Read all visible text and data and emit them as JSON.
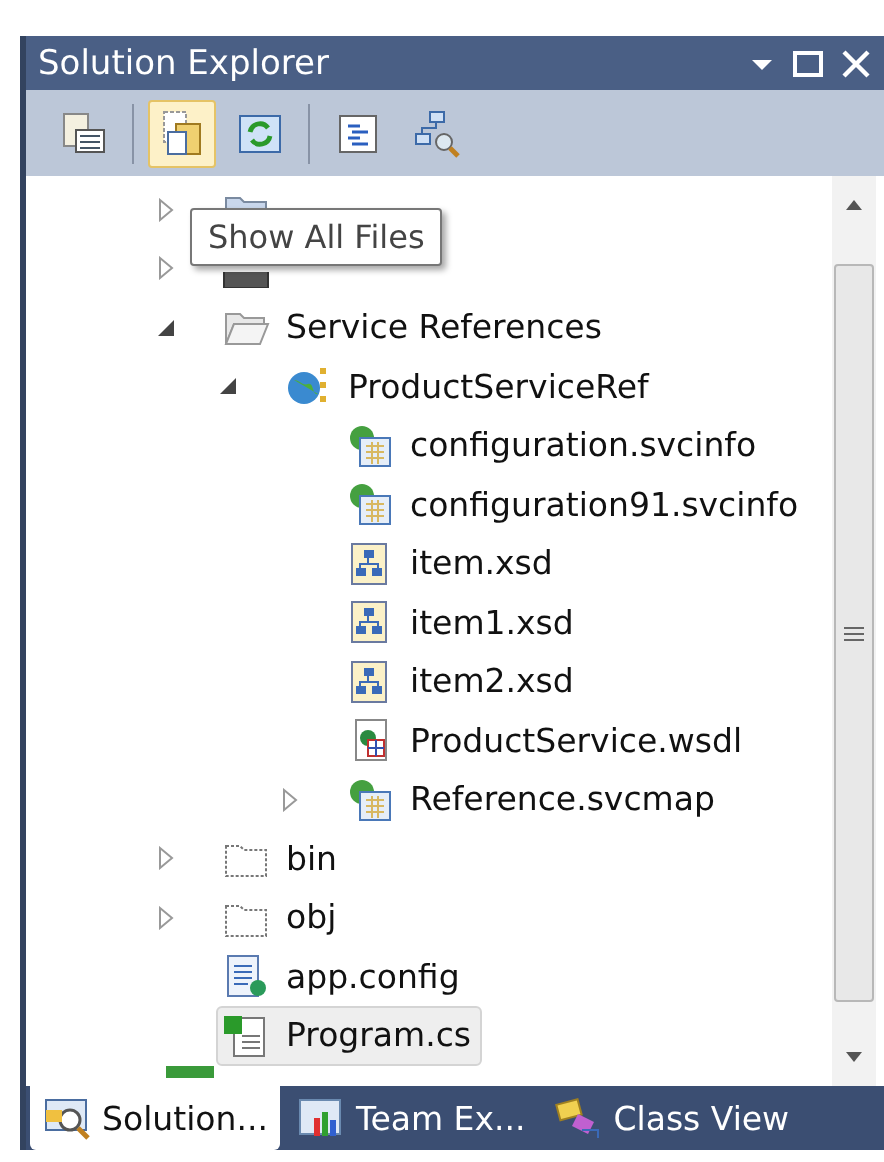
{
  "window": {
    "title": "Solution Explorer"
  },
  "toolbar": [
    {
      "kind": "properties",
      "selected": false
    },
    {
      "kind": "show-all",
      "selected": true
    },
    {
      "kind": "refresh",
      "selected": false
    },
    {
      "kind": "view-code",
      "selected": false
    },
    {
      "kind": "class-diagram",
      "selected": false
    }
  ],
  "tooltip": "Show All Files",
  "tree": [
    {
      "kind": "folder-props",
      "expanded": false,
      "selected": false
    },
    {
      "kind": "references",
      "expanded": false,
      "selected": false
    },
    {
      "name": "Service References",
      "kind": "folder-open",
      "expanded": true,
      "selected": false,
      "children": [
        {
          "name": "ProductServiceRef",
          "kind": "service",
          "expanded": true,
          "selected": false,
          "children": [
            {
              "name": "configuration.svcinfo",
              "kind": "svcinfo",
              "selected": false
            },
            {
              "name": "configuration91.svcinfo",
              "kind": "svcinfo",
              "selected": false
            },
            {
              "name": "item.xsd",
              "kind": "xsd",
              "selected": false
            },
            {
              "name": "item1.xsd",
              "kind": "xsd",
              "selected": false
            },
            {
              "name": "item2.xsd",
              "kind": "xsd",
              "selected": false
            },
            {
              "name": "ProductService.wsdl",
              "kind": "wsdl",
              "selected": false
            },
            {
              "name": "Reference.svcmap",
              "kind": "svcinfo",
              "expanded": false,
              "selected": false
            }
          ]
        }
      ]
    },
    {
      "name": "bin",
      "kind": "folder-hidden",
      "expanded": false,
      "selected": false
    },
    {
      "name": "obj",
      "kind": "folder-hidden",
      "expanded": false,
      "selected": false
    },
    {
      "name": "app.config",
      "kind": "config",
      "selected": false
    },
    {
      "name": "Program.cs",
      "kind": "csharp",
      "selected": true
    }
  ],
  "tabs": [
    {
      "label": "Solution...",
      "kind": "solution",
      "selected": true
    },
    {
      "label": "Team Ex...",
      "kind": "team",
      "selected": false
    },
    {
      "label": "Class View",
      "kind": "class",
      "selected": false
    }
  ]
}
